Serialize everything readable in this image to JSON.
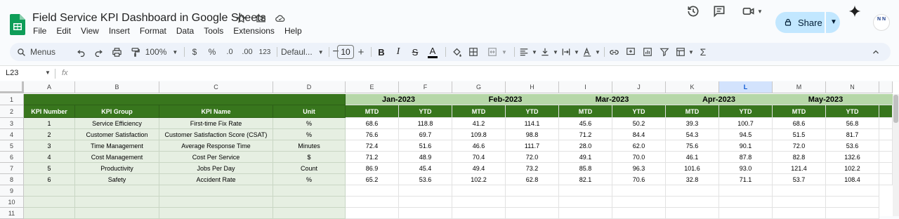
{
  "app": {
    "doc_title": "Field Service KPI Dashboard in Google Sheets",
    "menu": [
      "File",
      "Edit",
      "View",
      "Insert",
      "Format",
      "Data",
      "Tools",
      "Extensions",
      "Help"
    ],
    "share_label": "Share",
    "avatar_text": "N N"
  },
  "toolbar": {
    "menus_label": "Menus",
    "zoom": "100%",
    "currency": "$",
    "percent": "%",
    "dec_less": ".0",
    "dec_more": ".00",
    "num_format": "123",
    "font": "Defaul...",
    "font_size": "10"
  },
  "formula_bar": {
    "cell_ref": "L23",
    "fx": "fx"
  },
  "sheet": {
    "columns": [
      "A",
      "B",
      "C",
      "D",
      "E",
      "F",
      "G",
      "H",
      "I",
      "J",
      "K",
      "L",
      "M",
      "N"
    ],
    "selected_column": "L",
    "rows": [
      "1",
      "2",
      "3",
      "4",
      "5",
      "6",
      "7",
      "8",
      "9",
      "10",
      "11"
    ],
    "headers": [
      "KPI Number",
      "KPI Group",
      "KPI Name",
      "Unit"
    ],
    "months": [
      "Jan-2023",
      "Feb-2023",
      "Mar-2023",
      "Apr-2023",
      "May-2023"
    ],
    "sub_headers": [
      "MTD",
      "YTD"
    ],
    "data": [
      [
        "1",
        "Service Efficiency",
        "First-time Fix Rate",
        "%",
        "68.6",
        "118.8",
        "41.2",
        "114.1",
        "45.6",
        "50.2",
        "39.3",
        "100.7",
        "68.6",
        "56.8"
      ],
      [
        "2",
        "Customer Satisfaction",
        "Customer Satisfaction Score (CSAT)",
        "%",
        "76.6",
        "69.7",
        "109.8",
        "98.8",
        "71.2",
        "84.4",
        "54.3",
        "94.5",
        "51.5",
        "81.7"
      ],
      [
        "3",
        "Time Management",
        "Average Response Time",
        "Minutes",
        "72.4",
        "51.6",
        "46.6",
        "111.7",
        "28.0",
        "62.0",
        "75.6",
        "90.1",
        "72.0",
        "53.6"
      ],
      [
        "4",
        "Cost Management",
        "Cost Per Service",
        "$",
        "71.2",
        "48.9",
        "70.4",
        "72.0",
        "49.1",
        "70.0",
        "46.1",
        "87.8",
        "82.8",
        "132.6"
      ],
      [
        "5",
        "Productivity",
        "Jobs Per Day",
        "Count",
        "86.9",
        "45.4",
        "49.4",
        "73.2",
        "85.8",
        "96.3",
        "101.6",
        "93.0",
        "121.4",
        "102.2"
      ],
      [
        "6",
        "Safety",
        "Accident Rate",
        "%",
        "65.2",
        "53.6",
        "102.2",
        "62.8",
        "82.1",
        "70.6",
        "32.8",
        "71.1",
        "53.7",
        "108.4"
      ]
    ]
  },
  "colors": {
    "header_green": "#38761d",
    "month_band": "#b6d7a8",
    "left_fill": "#e6efe2",
    "share_bg": "#c2e7ff"
  }
}
